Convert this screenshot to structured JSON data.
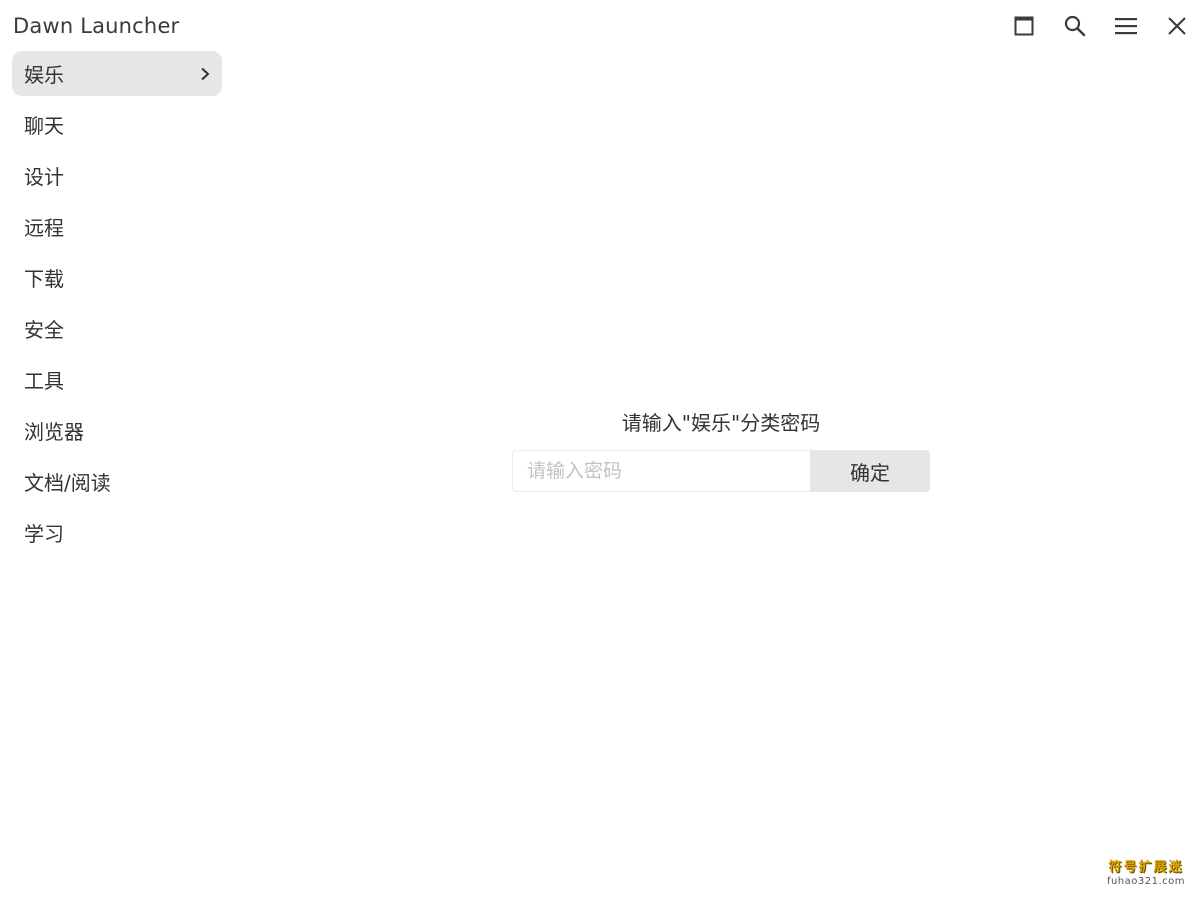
{
  "app": {
    "title": "Dawn Launcher"
  },
  "window_controls": [
    {
      "name": "maximize",
      "icon": "maximize-icon"
    },
    {
      "name": "search",
      "icon": "search-icon"
    },
    {
      "name": "menu",
      "icon": "menu-icon"
    },
    {
      "name": "close",
      "icon": "close-icon"
    }
  ],
  "sidebar": {
    "items": [
      {
        "label": "娱乐",
        "active": true
      },
      {
        "label": "聊天",
        "active": false
      },
      {
        "label": "设计",
        "active": false
      },
      {
        "label": "远程",
        "active": false
      },
      {
        "label": "下载",
        "active": false
      },
      {
        "label": "安全",
        "active": false
      },
      {
        "label": "工具",
        "active": false
      },
      {
        "label": "浏览器",
        "active": false
      },
      {
        "label": "文档/阅读",
        "active": false
      },
      {
        "label": "学习",
        "active": false
      }
    ]
  },
  "lock": {
    "prompt": "请输入\"娱乐\"分类密码",
    "placeholder": "请输入密码",
    "value": "",
    "confirm_label": "确定"
  },
  "watermark": {
    "main": "符号扩展迷",
    "sub": "fuhao321.com"
  },
  "colors": {
    "background": "#ffffff",
    "text": "#333333",
    "active_item_bg": "#e6e6e6",
    "button_bg": "#e6e6e6",
    "placeholder": "#c2c2c2"
  }
}
